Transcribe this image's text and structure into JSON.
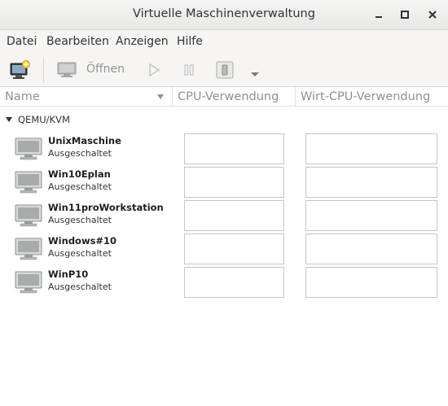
{
  "window": {
    "title": "Virtuelle Maschinenverwaltung"
  },
  "menubar": {
    "items": [
      "Datei",
      "Bearbeiten",
      "Anzeigen",
      "Hilfe"
    ]
  },
  "toolbar": {
    "open_label": "Öffnen"
  },
  "columns": {
    "name": "Name",
    "cpu": "CPU-Verwendung",
    "host_cpu": "Wirt-CPU-Verwendung"
  },
  "group": {
    "label": "QEMU/KVM"
  },
  "vms": [
    {
      "name": "UnixMaschine",
      "status": "Ausgeschaltet"
    },
    {
      "name": "Win10Eplan",
      "status": "Ausgeschaltet"
    },
    {
      "name": "Win11proWorkstation",
      "status": "Ausgeschaltet"
    },
    {
      "name": "Windows#10",
      "status": "Ausgeschaltet"
    },
    {
      "name": "WinP10",
      "status": "Ausgeschaltet"
    }
  ]
}
